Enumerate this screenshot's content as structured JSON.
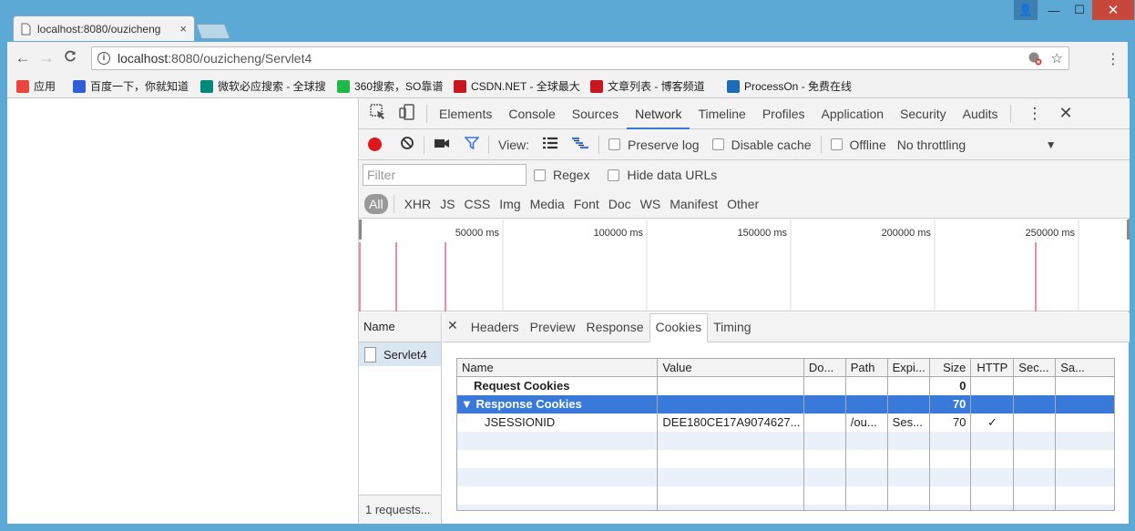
{
  "browser": {
    "tab_title": "localhost:8080/ouzicheng",
    "tab_close": "×",
    "url_host": "localhost",
    "url_rest": ":8080/ouzicheng/Servlet4",
    "back_icon": "←",
    "forward_icon": "→",
    "reload_icon": "C",
    "star_icon": "☆",
    "menu_icon": "⋮",
    "window_user": "👤",
    "window_min": "—",
    "window_max": "☐",
    "window_close": "✕"
  },
  "bookmarks": [
    {
      "label": "应用",
      "icon": "apps-icon",
      "color": "#e8453c"
    },
    {
      "label": "百度一下，你就知道",
      "icon": "baidu-icon",
      "color": "#2f5fd7"
    },
    {
      "label": "微软必应搜索 - 全球搜",
      "icon": "bing-icon",
      "color": "#00897b"
    },
    {
      "label": "360搜索，SO靠谱",
      "icon": "so360-icon",
      "color": "#1fb94b"
    },
    {
      "label": "CSDN.NET - 全球最大",
      "icon": "csdn-icon",
      "color": "#c81623"
    },
    {
      "label": "文章列表 - 博客频道",
      "icon": "csdn-blog-icon",
      "color": "#c81623"
    },
    {
      "label": "ProcessOn - 免费在线",
      "icon": "processon-icon",
      "color": "#1e6bb8"
    }
  ],
  "devtools": {
    "tabs": [
      "Elements",
      "Console",
      "Sources",
      "Network",
      "Timeline",
      "Profiles",
      "Application",
      "Security",
      "Audits"
    ],
    "active_tab": "Network",
    "network_toolbar": {
      "view_label": "View:",
      "preserve_log": "Preserve log",
      "disable_cache": "Disable cache",
      "offline": "Offline",
      "throttling": "No throttling"
    },
    "filter": {
      "placeholder": "Filter",
      "regex": "Regex",
      "hide_data_urls": "Hide data URLs"
    },
    "types": [
      "All",
      "XHR",
      "JS",
      "CSS",
      "Img",
      "Media",
      "Font",
      "Doc",
      "WS",
      "Manifest",
      "Other"
    ],
    "timeline_ticks": [
      "50000 ms",
      "100000 ms",
      "150000 ms",
      "200000 ms",
      "250000 ms"
    ],
    "request_list": {
      "header": "Name",
      "requests": [
        "Servlet4"
      ],
      "footer": "1 requests..."
    },
    "detail_tabs": [
      "Headers",
      "Preview",
      "Response",
      "Cookies",
      "Timing"
    ],
    "active_detail_tab": "Cookies",
    "cookie_table": {
      "columns": [
        "Name",
        "Value",
        "Do...",
        "Path",
        "Expi...",
        "Size",
        "HTTP",
        "Sec...",
        "Sa..."
      ],
      "request_group": {
        "name": "Request Cookies",
        "size": "0"
      },
      "response_group": {
        "name": "▼ Response Cookies",
        "size": "70"
      },
      "cookies": [
        {
          "name": "JSESSIONID",
          "value": "DEE180CE17A9074627...",
          "domain": "",
          "path": "/ou...",
          "expires": "Ses...",
          "size": "70",
          "http": "✓",
          "secure": "",
          "samesite": ""
        }
      ]
    }
  }
}
